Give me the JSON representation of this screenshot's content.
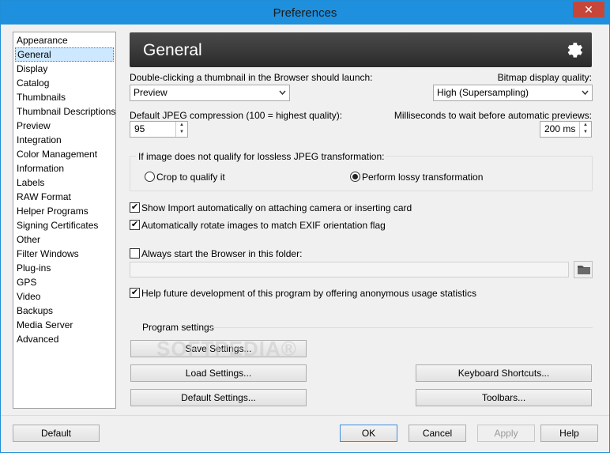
{
  "window": {
    "title": "Preferences",
    "close_glyph": "✕"
  },
  "sidebar": {
    "items": [
      {
        "label": "Appearance"
      },
      {
        "label": "General",
        "selected": true
      },
      {
        "label": "Display"
      },
      {
        "label": "Catalog"
      },
      {
        "label": "Thumbnails"
      },
      {
        "label": "Thumbnail Descriptions"
      },
      {
        "label": "Preview"
      },
      {
        "label": "Integration"
      },
      {
        "label": "Color Management"
      },
      {
        "label": "Information"
      },
      {
        "label": "Labels"
      },
      {
        "label": "RAW Format"
      },
      {
        "label": "Helper Programs"
      },
      {
        "label": "Signing Certificates"
      },
      {
        "label": "Other"
      },
      {
        "label": "Filter Windows"
      },
      {
        "label": "Plug-ins"
      },
      {
        "label": "GPS"
      },
      {
        "label": "Video"
      },
      {
        "label": "Backups"
      },
      {
        "label": "Media Server"
      },
      {
        "label": "Advanced"
      }
    ]
  },
  "header": {
    "title": "General",
    "icon": "gear-icon"
  },
  "general": {
    "double_click_label": "Double-clicking a thumbnail in the Browser should launch:",
    "double_click_value": "Preview",
    "bitmap_quality_label": "Bitmap display quality:",
    "bitmap_quality_value": "High (Supersampling)",
    "jpeg_compression_label": "Default JPEG compression (100 = highest quality):",
    "jpeg_compression_value": "95",
    "preview_wait_label": "Milliseconds to wait before automatic previews:",
    "preview_wait_value": "200 ms",
    "lossless_group_label": "If image does not qualify for lossless JPEG transformation:",
    "radio_crop_label": "Crop to qualify it",
    "radio_crop_selected": false,
    "radio_lossy_label": "Perform lossy transformation",
    "radio_lossy_selected": true,
    "show_import_label": "Show Import automatically on attaching camera or inserting card",
    "show_import_checked": true,
    "auto_rotate_label": "Automatically rotate images to match EXIF orientation flag",
    "auto_rotate_checked": true,
    "always_start_label": "Always start the Browser in this folder:",
    "always_start_checked": false,
    "folder_path_value": "",
    "help_dev_label": "Help future development of this program by offering anonymous usage statistics",
    "help_dev_checked": true,
    "check_glyph": "✔"
  },
  "program_settings": {
    "label": "Program settings",
    "save_button": "Save Settings...",
    "load_button": "Load Settings...",
    "default_button": "Default Settings...",
    "keyboard_button": "Keyboard Shortcuts...",
    "toolbars_button": "Toolbars..."
  },
  "watermark": {
    "text": "SOFTPEDIA®"
  },
  "footer": {
    "default_button": "Default",
    "ok_button": "OK",
    "cancel_button": "Cancel",
    "apply_button": "Apply",
    "help_button": "Help"
  },
  "colors": {
    "titlebar": "#1e90dd",
    "close": "#c7463a",
    "header_bg": "#333333",
    "selected_bg": "#cde8ff"
  }
}
